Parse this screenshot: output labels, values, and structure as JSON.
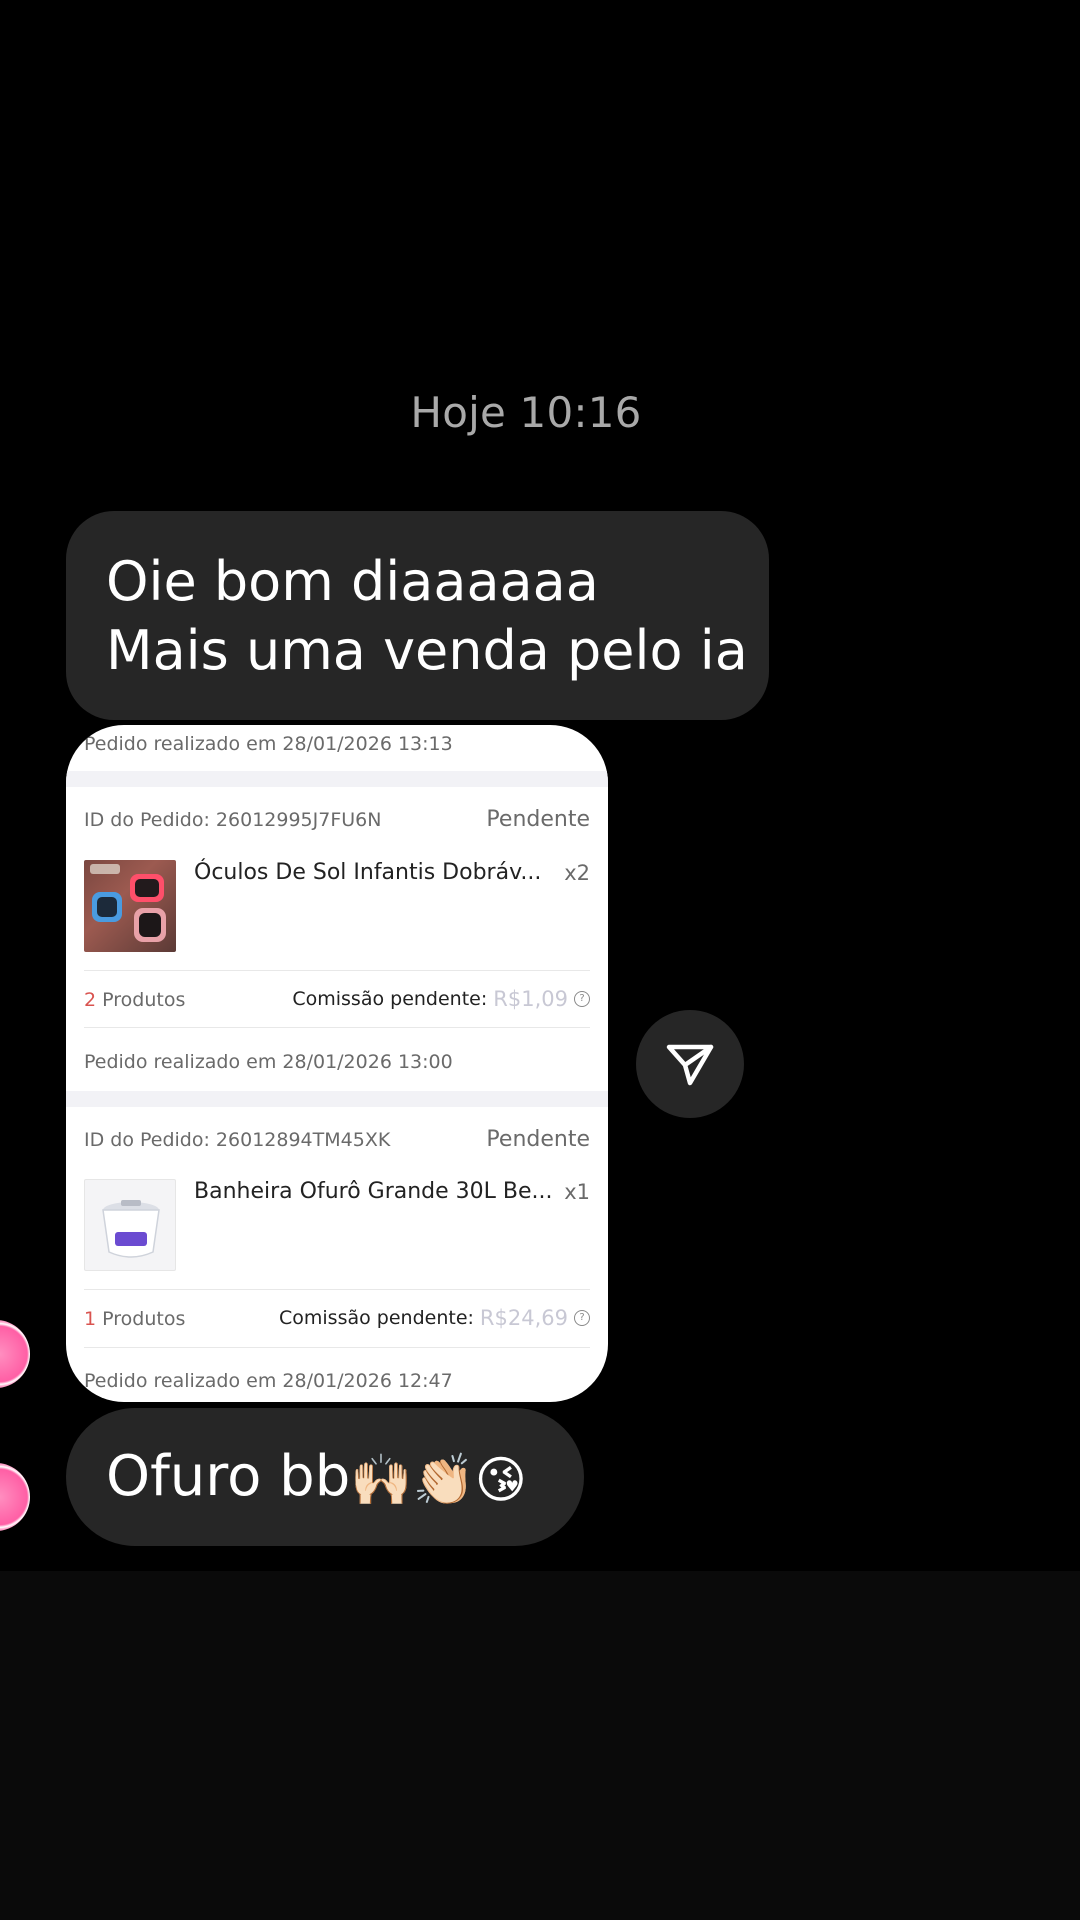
{
  "chat": {
    "timestamp": "Hoje 10:16",
    "message_1_line_1": "Oie bom diaaaaaa",
    "message_1_line_2": "Mais uma venda pelo ia",
    "message_3_text": "Ofuro bb",
    "message_3_emojis": "🙌🏻👏🏻😘"
  },
  "shared_screenshot": {
    "orders": [
      {
        "placed_label": "Pedido realizado em 28/01/2026 13:13",
        "id_label": "ID do Pedido: 26012995J7FU6N",
        "status": "Pendente",
        "product_name": "Óculos De Sol Infantis Dobráv...",
        "quantity": "x2",
        "products_count": "2",
        "products_label": "Produtos",
        "commission_label": "Comissão pendente:",
        "commission_value": "R$1,09"
      },
      {
        "placed_label": "Pedido realizado em 28/01/2026 13:00",
        "id_label": "ID do Pedido: 26012894TM45XK",
        "status": "Pendente",
        "product_name": "Banheira Ofurô Grande 30L Be...",
        "quantity": "x1",
        "products_count": "1",
        "products_label": "Produtos",
        "commission_label": "Comissão pendente:",
        "commission_value": "R$24,69"
      },
      {
        "placed_label": "Pedido realizado em 28/01/2026 12:47"
      }
    ]
  },
  "icons": {
    "share": "paper-plane-icon",
    "help": "question-circle-icon"
  },
  "colors": {
    "background": "#000000",
    "bubble": "#262626",
    "timestamp_text": "#a9a9a9",
    "avatar_accent": "#ff5fa5"
  }
}
